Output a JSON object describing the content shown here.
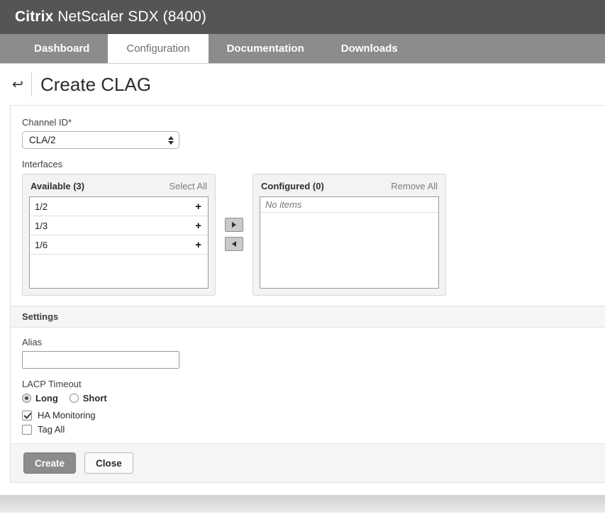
{
  "header": {
    "brand_strong": "Citrix",
    "brand_rest": " NetScaler SDX (8400)"
  },
  "tabs": [
    {
      "label": "Dashboard",
      "active": false
    },
    {
      "label": "Configuration",
      "active": true
    },
    {
      "label": "Documentation",
      "active": false
    },
    {
      "label": "Downloads",
      "active": false
    }
  ],
  "page": {
    "back_icon": "↩",
    "title": "Create CLAG"
  },
  "form": {
    "channel_id": {
      "label": "Channel ID*",
      "value": "CLA/2"
    },
    "interfaces_label": "Interfaces",
    "available": {
      "title": "Available (3)",
      "action": "Select All",
      "items": [
        {
          "name": "1/2",
          "icon": "+"
        },
        {
          "name": "1/3",
          "icon": "+"
        },
        {
          "name": "1/6",
          "icon": "+"
        }
      ]
    },
    "configured": {
      "title": "Configured (0)",
      "action": "Remove All",
      "empty_text": "No items",
      "items": []
    },
    "transfer": {
      "add_icon": "triangle-right-icon",
      "remove_icon": "triangle-left-icon"
    }
  },
  "settings": {
    "section_title": "Settings",
    "alias": {
      "label": "Alias",
      "value": "",
      "placeholder": ""
    },
    "lacp_timeout": {
      "label": "LACP Timeout",
      "selected": "Long",
      "options": [
        {
          "label": "Long",
          "selected": true
        },
        {
          "label": "Short",
          "selected": false
        }
      ]
    },
    "checkboxes": [
      {
        "label": "HA Monitoring",
        "checked": true
      },
      {
        "label": "Tag All",
        "checked": false
      }
    ]
  },
  "actions": {
    "create_label": "Create",
    "close_label": "Close"
  },
  "colors": {
    "brandbar": "#555557",
    "tabbar": "#8c8c8e",
    "active_tab": "#ffffff",
    "primary_button": "#8c8c8e",
    "section_bg": "#f5f5f5",
    "panel_bg": "#f3f3f3"
  }
}
